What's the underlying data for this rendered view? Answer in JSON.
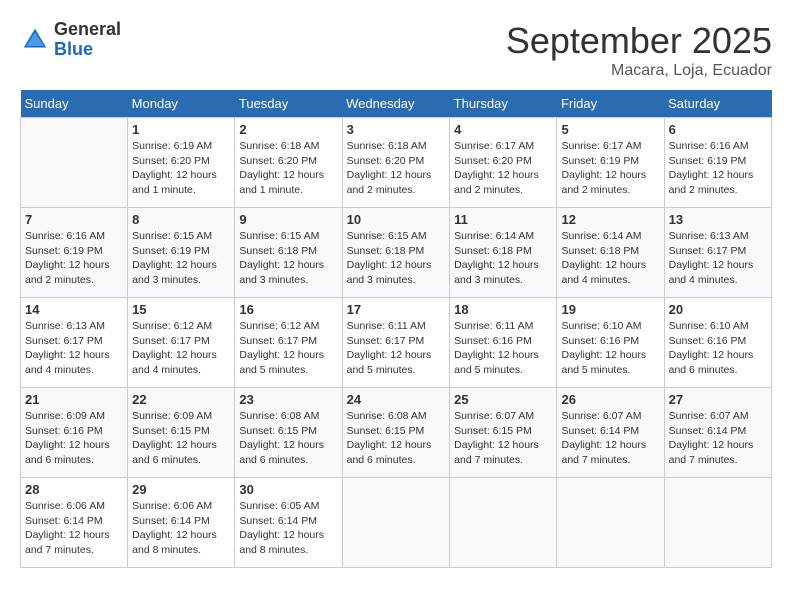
{
  "header": {
    "logo_general": "General",
    "logo_blue": "Blue",
    "month_title": "September 2025",
    "subtitle": "Macara, Loja, Ecuador"
  },
  "days_of_week": [
    "Sunday",
    "Monday",
    "Tuesday",
    "Wednesday",
    "Thursday",
    "Friday",
    "Saturday"
  ],
  "weeks": [
    [
      {
        "day": "",
        "info": ""
      },
      {
        "day": "1",
        "info": "Sunrise: 6:19 AM\nSunset: 6:20 PM\nDaylight: 12 hours\nand 1 minute."
      },
      {
        "day": "2",
        "info": "Sunrise: 6:18 AM\nSunset: 6:20 PM\nDaylight: 12 hours\nand 1 minute."
      },
      {
        "day": "3",
        "info": "Sunrise: 6:18 AM\nSunset: 6:20 PM\nDaylight: 12 hours\nand 2 minutes."
      },
      {
        "day": "4",
        "info": "Sunrise: 6:17 AM\nSunset: 6:20 PM\nDaylight: 12 hours\nand 2 minutes."
      },
      {
        "day": "5",
        "info": "Sunrise: 6:17 AM\nSunset: 6:19 PM\nDaylight: 12 hours\nand 2 minutes."
      },
      {
        "day": "6",
        "info": "Sunrise: 6:16 AM\nSunset: 6:19 PM\nDaylight: 12 hours\nand 2 minutes."
      }
    ],
    [
      {
        "day": "7",
        "info": "Sunrise: 6:16 AM\nSunset: 6:19 PM\nDaylight: 12 hours\nand 2 minutes."
      },
      {
        "day": "8",
        "info": "Sunrise: 6:15 AM\nSunset: 6:19 PM\nDaylight: 12 hours\nand 3 minutes."
      },
      {
        "day": "9",
        "info": "Sunrise: 6:15 AM\nSunset: 6:18 PM\nDaylight: 12 hours\nand 3 minutes."
      },
      {
        "day": "10",
        "info": "Sunrise: 6:15 AM\nSunset: 6:18 PM\nDaylight: 12 hours\nand 3 minutes."
      },
      {
        "day": "11",
        "info": "Sunrise: 6:14 AM\nSunset: 6:18 PM\nDaylight: 12 hours\nand 3 minutes."
      },
      {
        "day": "12",
        "info": "Sunrise: 6:14 AM\nSunset: 6:18 PM\nDaylight: 12 hours\nand 4 minutes."
      },
      {
        "day": "13",
        "info": "Sunrise: 6:13 AM\nSunset: 6:17 PM\nDaylight: 12 hours\nand 4 minutes."
      }
    ],
    [
      {
        "day": "14",
        "info": "Sunrise: 6:13 AM\nSunset: 6:17 PM\nDaylight: 12 hours\nand 4 minutes."
      },
      {
        "day": "15",
        "info": "Sunrise: 6:12 AM\nSunset: 6:17 PM\nDaylight: 12 hours\nand 4 minutes."
      },
      {
        "day": "16",
        "info": "Sunrise: 6:12 AM\nSunset: 6:17 PM\nDaylight: 12 hours\nand 5 minutes."
      },
      {
        "day": "17",
        "info": "Sunrise: 6:11 AM\nSunset: 6:17 PM\nDaylight: 12 hours\nand 5 minutes."
      },
      {
        "day": "18",
        "info": "Sunrise: 6:11 AM\nSunset: 6:16 PM\nDaylight: 12 hours\nand 5 minutes."
      },
      {
        "day": "19",
        "info": "Sunrise: 6:10 AM\nSunset: 6:16 PM\nDaylight: 12 hours\nand 5 minutes."
      },
      {
        "day": "20",
        "info": "Sunrise: 6:10 AM\nSunset: 6:16 PM\nDaylight: 12 hours\nand 6 minutes."
      }
    ],
    [
      {
        "day": "21",
        "info": "Sunrise: 6:09 AM\nSunset: 6:16 PM\nDaylight: 12 hours\nand 6 minutes."
      },
      {
        "day": "22",
        "info": "Sunrise: 6:09 AM\nSunset: 6:15 PM\nDaylight: 12 hours\nand 6 minutes."
      },
      {
        "day": "23",
        "info": "Sunrise: 6:08 AM\nSunset: 6:15 PM\nDaylight: 12 hours\nand 6 minutes."
      },
      {
        "day": "24",
        "info": "Sunrise: 6:08 AM\nSunset: 6:15 PM\nDaylight: 12 hours\nand 6 minutes."
      },
      {
        "day": "25",
        "info": "Sunrise: 6:07 AM\nSunset: 6:15 PM\nDaylight: 12 hours\nand 7 minutes."
      },
      {
        "day": "26",
        "info": "Sunrise: 6:07 AM\nSunset: 6:14 PM\nDaylight: 12 hours\nand 7 minutes."
      },
      {
        "day": "27",
        "info": "Sunrise: 6:07 AM\nSunset: 6:14 PM\nDaylight: 12 hours\nand 7 minutes."
      }
    ],
    [
      {
        "day": "28",
        "info": "Sunrise: 6:06 AM\nSunset: 6:14 PM\nDaylight: 12 hours\nand 7 minutes."
      },
      {
        "day": "29",
        "info": "Sunrise: 6:06 AM\nSunset: 6:14 PM\nDaylight: 12 hours\nand 8 minutes."
      },
      {
        "day": "30",
        "info": "Sunrise: 6:05 AM\nSunset: 6:14 PM\nDaylight: 12 hours\nand 8 minutes."
      },
      {
        "day": "",
        "info": ""
      },
      {
        "day": "",
        "info": ""
      },
      {
        "day": "",
        "info": ""
      },
      {
        "day": "",
        "info": ""
      }
    ]
  ]
}
